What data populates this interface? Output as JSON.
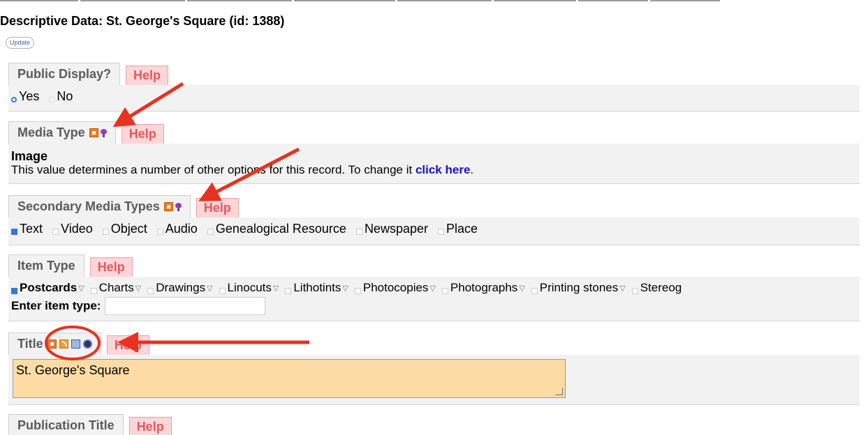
{
  "page": {
    "title": "Descriptive Data: St. George's Square (id: 1388)",
    "update_label": "Update",
    "help_label": "Help"
  },
  "public_display": {
    "label": "Public Display?",
    "options": [
      "Yes",
      "No"
    ],
    "selected": "Yes"
  },
  "media_type": {
    "label": "Media Type",
    "icons": [
      "orange-square-icon",
      "lightbulb-icon"
    ],
    "value": "Image",
    "note_prefix": "This value determines a number of other options for this record. To change it",
    "note_link": "click here",
    "note_suffix": "."
  },
  "secondary_media_types": {
    "label": "Secondary Media Types",
    "icons": [
      "orange-square-icon",
      "lightbulb-icon"
    ],
    "options": [
      "Text",
      "Video",
      "Object",
      "Audio",
      "Genealogical Resource",
      "Newspaper",
      "Place"
    ],
    "checked": [
      "Text"
    ]
  },
  "item_type": {
    "label": "Item Type",
    "options": [
      "Postcards",
      "Charts",
      "Drawings",
      "Linocuts",
      "Lithotints",
      "Photocopies",
      "Photographs",
      "Printing stones",
      "Stereog"
    ],
    "checked": [
      "Postcards"
    ],
    "enter_label": "Enter item type:",
    "enter_value": ""
  },
  "title_field": {
    "label": "Title",
    "icons": [
      "orange-square-icon",
      "rss-icon",
      "blue-square-icon",
      "globe-icon"
    ],
    "value": "St. George's Square"
  },
  "publication_title": {
    "label": "Publication Title"
  },
  "annotations": {
    "arrow_color": "#e8321f",
    "circle_color": "#e8321f"
  }
}
